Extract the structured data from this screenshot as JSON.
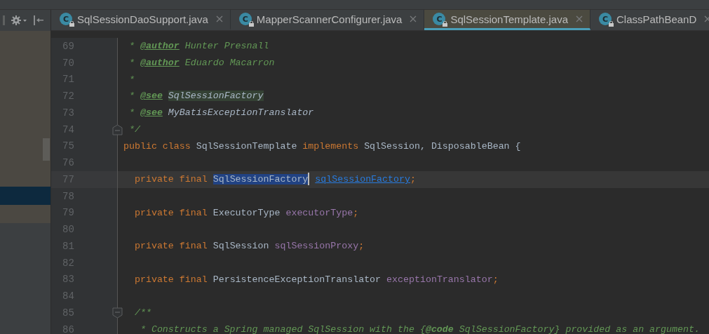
{
  "tabs": [
    {
      "icon_letter": "C",
      "label": "SqlSessionDaoSupport.java",
      "selected": false
    },
    {
      "icon_letter": "C",
      "label": "MapperScannerConfigurer.java",
      "selected": false
    },
    {
      "icon_letter": "C",
      "label": "SqlSessionTemplate.java",
      "selected": true
    },
    {
      "icon_letter": "C",
      "label": "ClassPathBeanD",
      "selected": false
    }
  ],
  "editor": {
    "lines": [
      {
        "number": "69",
        "tokens": [
          {
            "kind": "comment",
            "text": " * "
          },
          {
            "kind": "tag",
            "text": "@author"
          },
          {
            "kind": "comment",
            "text": " Hunter Presnall"
          }
        ]
      },
      {
        "number": "70",
        "tokens": [
          {
            "kind": "comment",
            "text": " * "
          },
          {
            "kind": "tag",
            "text": "@author"
          },
          {
            "kind": "comment",
            "text": " Eduardo Macarron"
          }
        ]
      },
      {
        "number": "71",
        "tokens": [
          {
            "kind": "comment",
            "text": " *"
          }
        ]
      },
      {
        "number": "72",
        "tokens": [
          {
            "kind": "comment",
            "text": " * "
          },
          {
            "kind": "tag",
            "text": "@see"
          },
          {
            "kind": "ref",
            "text": " SqlSessionFactory",
            "highlighted": true
          }
        ]
      },
      {
        "number": "73",
        "tokens": [
          {
            "kind": "comment",
            "text": " * "
          },
          {
            "kind": "tag",
            "text": "@see"
          },
          {
            "kind": "ref",
            "text": " MyBatisExceptionTranslator"
          }
        ]
      },
      {
        "number": "74",
        "fold_end": true,
        "tokens": [
          {
            "kind": "comment",
            "text": " */"
          }
        ]
      },
      {
        "number": "75",
        "tokens": [
          {
            "kind": "keyword",
            "text": "public class "
          },
          {
            "kind": "plain",
            "text": "SqlSessionTemplate "
          },
          {
            "kind": "keyword",
            "text": "implements "
          },
          {
            "kind": "plain",
            "text": "SqlSession, DisposableBean {"
          }
        ]
      },
      {
        "number": "76"
      },
      {
        "number": "77",
        "current": true,
        "tokens": [
          {
            "kind": "keyword",
            "text": "  private final "
          },
          {
            "kind": "selection",
            "text": "SqlSessionFactory"
          },
          {
            "kind": "caret"
          },
          {
            "kind": "link",
            "text": " sqlSessionFactory"
          },
          {
            "kind": "keyword",
            "text": ";"
          }
        ]
      },
      {
        "number": "78"
      },
      {
        "number": "79",
        "tokens": [
          {
            "kind": "keyword",
            "text": "  private final "
          },
          {
            "kind": "plain",
            "text": "ExecutorType "
          },
          {
            "kind": "field",
            "text": "executorType"
          },
          {
            "kind": "keyword",
            "text": ";"
          }
        ]
      },
      {
        "number": "80"
      },
      {
        "number": "81",
        "tokens": [
          {
            "kind": "keyword",
            "text": "  private final "
          },
          {
            "kind": "plain",
            "text": "SqlSession "
          },
          {
            "kind": "field",
            "text": "sqlSessionProxy"
          },
          {
            "kind": "keyword",
            "text": ";"
          }
        ]
      },
      {
        "number": "82"
      },
      {
        "number": "83",
        "tokens": [
          {
            "kind": "keyword",
            "text": "  private final "
          },
          {
            "kind": "plain",
            "text": "PersistenceExceptionTranslator "
          },
          {
            "kind": "field",
            "text": "exceptionTranslator"
          },
          {
            "kind": "keyword",
            "text": ";"
          }
        ]
      },
      {
        "number": "84"
      },
      {
        "number": "85",
        "fold_start": true,
        "tokens": [
          {
            "kind": "comment",
            "text": "  /**"
          }
        ]
      },
      {
        "number": "86",
        "tokens": [
          {
            "kind": "comment",
            "text": "   * Constructs a Spring managed SqlSession with the {"
          },
          {
            "kind": "inline-tag",
            "text": "@code"
          },
          {
            "kind": "comment",
            "text": " SqlSessionFactory} provided as an argument."
          }
        ]
      }
    ]
  }
}
